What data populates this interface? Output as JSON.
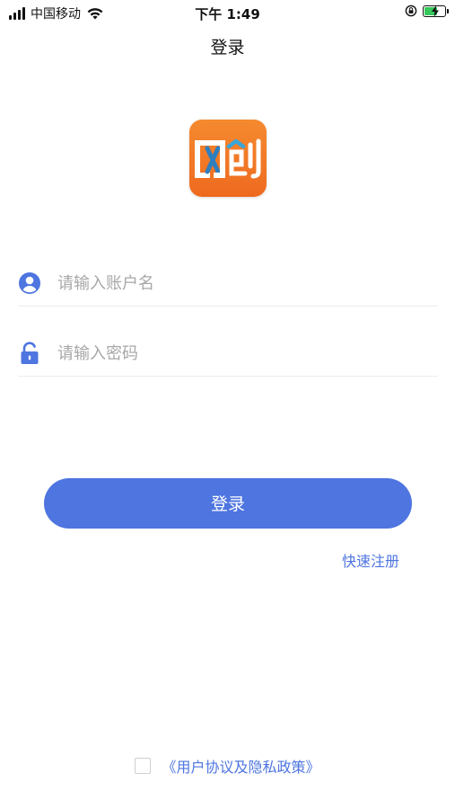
{
  "status_bar": {
    "carrier": "中国移动",
    "time": "下午 1:49",
    "icons": [
      "signal-bars-icon",
      "wifi-icon",
      "rotation-lock-icon",
      "battery-charging-icon"
    ]
  },
  "nav": {
    "title": "登录"
  },
  "logo": {
    "name": "app-logo",
    "colors": {
      "bg_top": "#f58a2f",
      "bg_bottom": "#ee6a1f",
      "accent": "#3aa6d8"
    }
  },
  "form": {
    "username": {
      "placeholder": "请输入账户名",
      "value": "",
      "icon": "user-icon"
    },
    "password": {
      "placeholder": "请输入密码",
      "value": "",
      "icon": "lock-icon"
    }
  },
  "actions": {
    "login_label": "登录",
    "register_label": "快速注册"
  },
  "agreement": {
    "checked": false,
    "label": "《用户协议及隐私政策》"
  },
  "colors": {
    "accent": "#4e75e0",
    "placeholder": "#a7a7a7",
    "divider": "#ececec"
  }
}
